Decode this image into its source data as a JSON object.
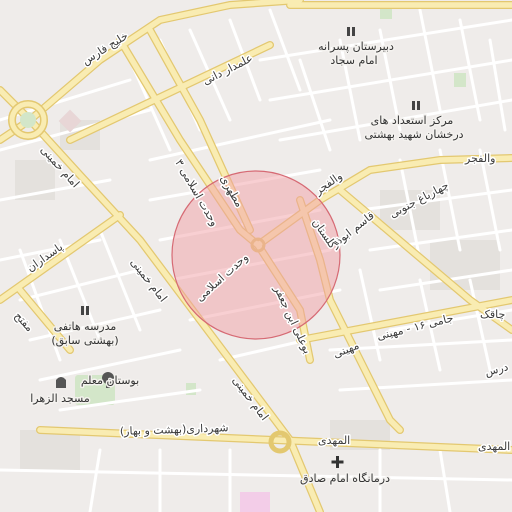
{
  "colors": {
    "background": "#efecea",
    "block": "#e3e0dc",
    "minor_road": "#ffffff",
    "main_road": "#f7e7a6",
    "main_road_casing": "#e6c96a",
    "park": "#cfe3c6",
    "water_circle": "#f4a7ad",
    "selection_fill": "#f2a0a6",
    "selection_stroke": "#d66a74"
  },
  "selection": {
    "shape": "circle",
    "opacity": 0.55
  },
  "roads": {
    "khalij_fars": "خلیج فارس",
    "alamdar_dani": "علمدار دانی",
    "imam_khomeini_1": "امام خمینی",
    "imam_khomeini_2": "امام خمینی",
    "imam_khomeini_3": "امام خمینی",
    "vahdat_eslami_1": "وحدت اسلامی ۳",
    "vahdat_eslami_2": "وحدت اسلامی",
    "motahari": "مطهری",
    "valfajr_1": "والفجر",
    "valfajr_2": "والفجر",
    "chaharbagh": "چهارباغ جنوبی",
    "ghasem_davar": "قاسم ابوذر",
    "golestan": "گلستان",
    "bu_ali": "بوعلی ابن جعفر",
    "pasdaran": "پاسداران",
    "mofateh": "مفتح",
    "mahini": "مهینی",
    "jami": "جامی ۱۶ - مهینی",
    "shahrdari": "شهرداری(بهشت و بهار)",
    "mahdi_1": "المهدی",
    "mahdi_2": "المهدی",
    "chalak": "چاقک",
    "edge_ros": "درس"
  },
  "pois": {
    "girls_school": {
      "line1": "دبیرستان پسرانه",
      "line2": "امام سجاد",
      "icon": "school-icon"
    },
    "talent_center": {
      "line1": "مرکز استعداد های",
      "line2": "درخشان شهید بهشتی",
      "icon": "school-icon"
    },
    "hatefi_school": {
      "line1": "مدرسه هاتفی",
      "line2": "(بهشتی سابق)",
      "icon": "school-icon"
    },
    "teacher_park": {
      "line1": "بوستان معلم",
      "icon": "tree-icon"
    },
    "zahra_mosque": {
      "line1": "مسجد الزهرا",
      "icon": "mosque-icon"
    },
    "imam_sadegh_clinic": {
      "line1": "درمانگاه امام صادق",
      "icon": "medical-cross-icon"
    }
  }
}
